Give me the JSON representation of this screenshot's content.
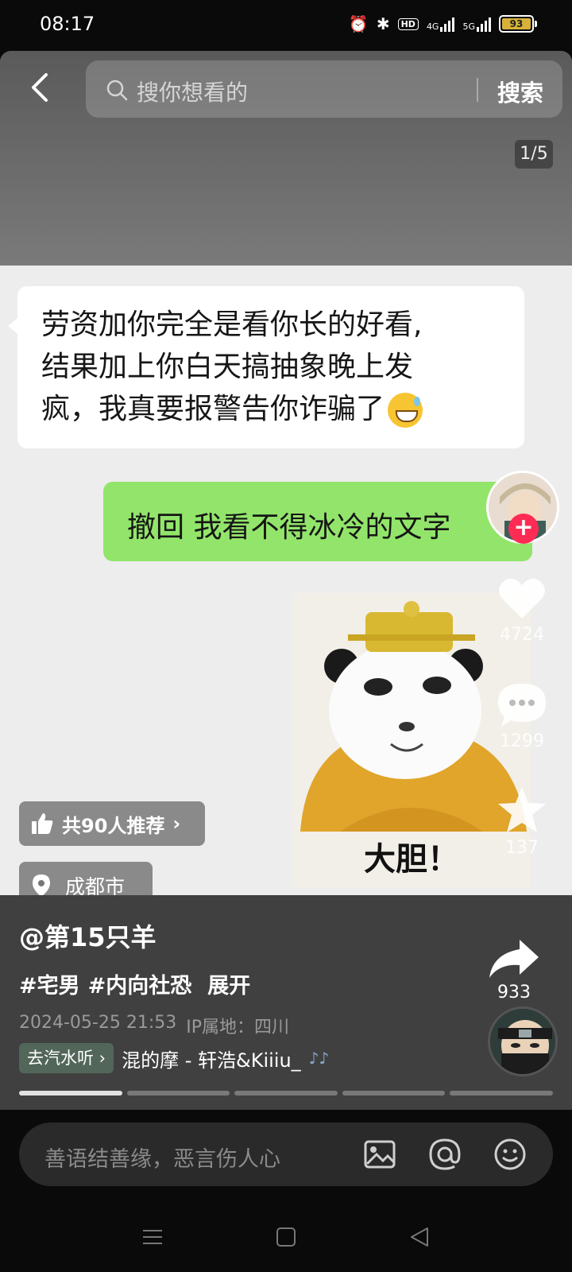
{
  "status_bar": {
    "time": "08:17",
    "network_1": "4G",
    "network_2": "5G",
    "hd_label": "HD",
    "battery": "93"
  },
  "header": {
    "search_placeholder": "搜你想看的",
    "search_button": "搜索",
    "page_indicator": "1/5"
  },
  "chat": {
    "left_message_lines": [
      "劳资加你完全是看你长的好看,",
      "结果加上你白天搞抽象晚上发",
      "疯，我真要报警告你诈骗了"
    ],
    "right_message": "撤回 我看不得冰冷的文字",
    "sticker_caption": "大胆！"
  },
  "actions": {
    "likes": "4724",
    "comments": "1299",
    "favorites": "137",
    "shares": "933"
  },
  "pills": {
    "recommend": "共90人推荐",
    "location": "成都市"
  },
  "post": {
    "author": "@第15只羊",
    "tags": [
      "#宅男",
      "#内向社恐"
    ],
    "expand": "展开",
    "date": "2024-05-25 21:53",
    "ip": "IP属地：四川",
    "music_tag": "去汽水听",
    "music_title": "混的摩 - 轩浩&Kiiiu_",
    "music_notes": "♪♪",
    "progress_segments": 5,
    "progress_active": 1
  },
  "comment_bar": {
    "placeholder": "善语结善缘，恶言伤人心"
  },
  "colors": {
    "accent_follow": "#fe2c55",
    "bubble_green": "#92e56a",
    "music_tag_bg": "#52665a"
  }
}
